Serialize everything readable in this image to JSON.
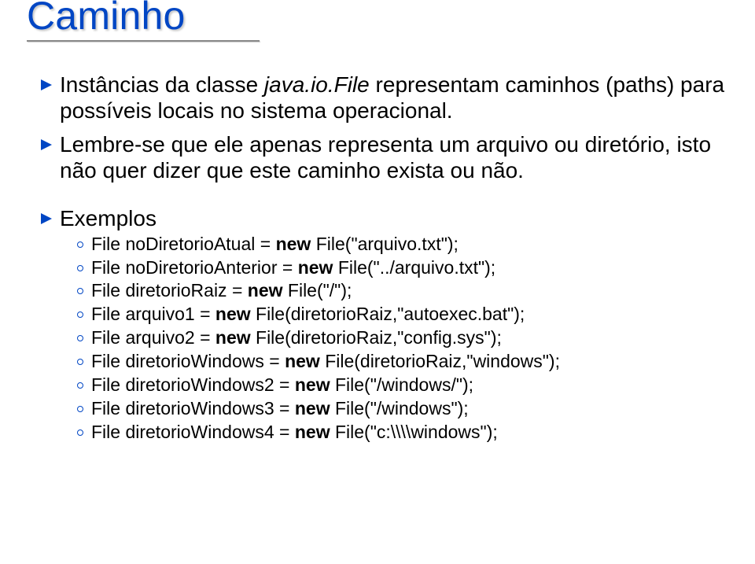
{
  "title": "Caminho",
  "p1_pre": "Instâncias da classe ",
  "p1_italic": "java.io.File ",
  "p1_post": "representam caminhos (paths) para possíveis locais no sistema operacional.",
  "p2": "Lembre-se que ele apenas representa um arquivo ou diretório, isto não quer dizer que este caminho exista ou não.",
  "examples_label": "Exemplos",
  "code": {
    "line1_a": "File noDiretorioAtual = ",
    "line1_b": "new ",
    "line1_c": "File(\"arquivo.txt\");",
    "line2_a": "File noDiretorioAnterior = ",
    "line2_b": "new ",
    "line2_c": "File(\"../arquivo.txt\");",
    "line3_a": "File diretorioRaiz = ",
    "line3_b": "new ",
    "line3_c": "File(\"/\");",
    "line4_a": "File arquivo1 = ",
    "line4_b": "new ",
    "line4_c": "File(diretorioRaiz,\"autoexec.bat\");",
    "line5_a": "File arquivo2 = ",
    "line5_b": "new ",
    "line5_c": "File(diretorioRaiz,\"config.sys\");",
    "line6_a": "File diretorioWindows = ",
    "line6_b": "new ",
    "line6_c": "File(diretorioRaiz,\"windows\");",
    "line7_a": "File diretorioWindows2 = ",
    "line7_b": "new ",
    "line7_c": "File(\"/windows/\");",
    "line8_a": "File diretorioWindows3 = ",
    "line8_b": "new ",
    "line8_c": "File(\"/windows\");",
    "line9_a": "File diretorioWindows4 = ",
    "line9_b": "new ",
    "line9_c": "File(\"c:\\\\\\\\windows\");"
  }
}
